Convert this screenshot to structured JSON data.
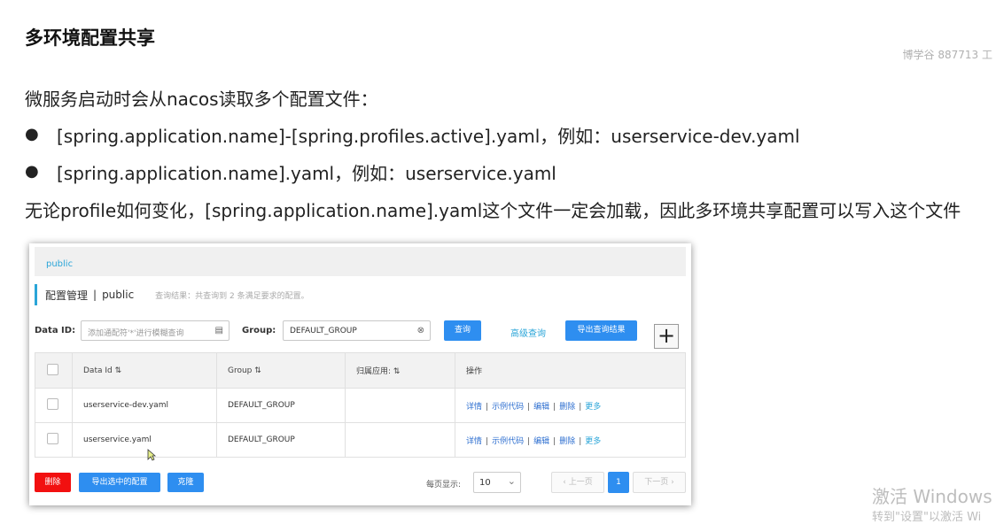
{
  "slide": {
    "title": "多环境配置共享",
    "watermark": "博学谷 887713 工",
    "intro": "微服务启动时会从nacos读取多个配置文件：",
    "bullets": [
      "[spring.application.name]-[spring.profiles.active].yaml，例如：userservice-dev.yaml",
      "[spring.application.name].yaml，例如：userservice.yaml"
    ],
    "note": "无论profile如何变化，[spring.application.name].yaml这个文件一定会加载，因此多环境共享配置可以写入这个文件"
  },
  "nacos": {
    "namespace_tab": "public",
    "header_title": "配置管理",
    "header_sep": "|",
    "header_namespace": "public",
    "result_text": "查询结果：共查询到 2 条满足要求的配置。",
    "search": {
      "data_id_label": "Data ID:",
      "data_id_placeholder": "添加通配符'*'进行模糊查询",
      "group_label": "Group:",
      "group_value": "DEFAULT_GROUP",
      "query_label": "查询",
      "advanced_label": "高级查询",
      "export_label": "导出查询结果",
      "add_label": "+"
    },
    "table": {
      "headers": [
        "Data Id",
        "Group",
        "归属应用:",
        "操作"
      ],
      "sort_icon": "⇅",
      "ops": [
        "详情",
        "示例代码",
        "编辑",
        "删除",
        "更多"
      ],
      "rows": [
        {
          "data_id": "userservice-dev.yaml",
          "group": "DEFAULT_GROUP",
          "app": ""
        },
        {
          "data_id": "userservice.yaml",
          "group": "DEFAULT_GROUP",
          "app": ""
        }
      ]
    },
    "footer": {
      "delete_label": "删除",
      "export_selected_label": "导出选中的配置",
      "clone_label": "克隆",
      "page_size_label": "每页显示:",
      "page_size": "10",
      "prev_label": "上一页",
      "current_page": "1",
      "next_label": "下一页"
    }
  },
  "os_watermark": {
    "line1": "激活 Windows",
    "line2": "转到\"设置\"以激活 Wi"
  }
}
